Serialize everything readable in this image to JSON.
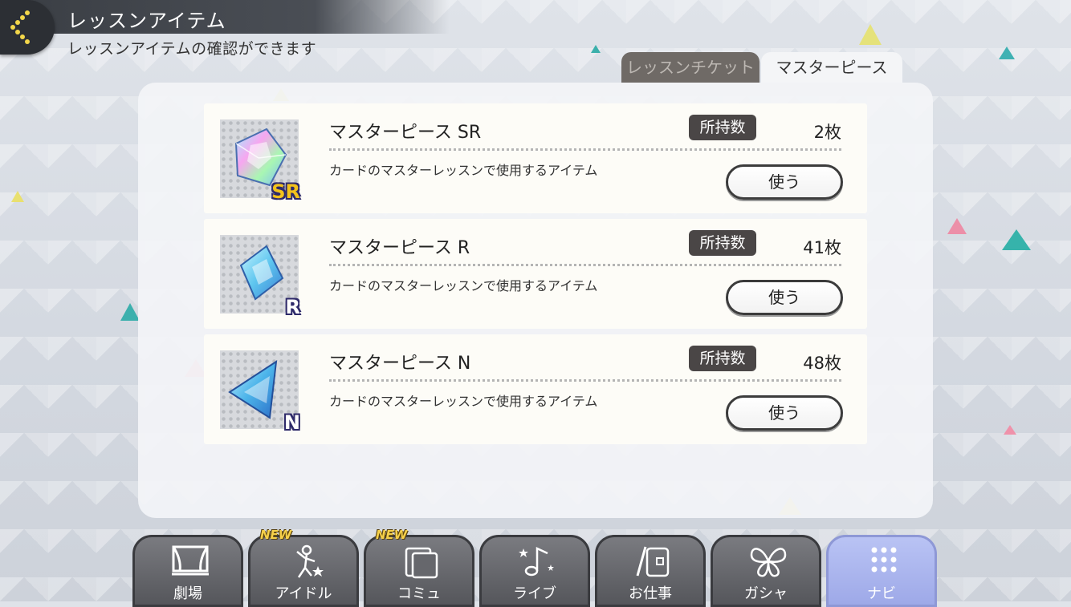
{
  "header": {
    "title": "レッスンアイテム",
    "subtitle": "レッスンアイテムの確認ができます"
  },
  "tabs": [
    {
      "label": "レッスンチケット",
      "active": false
    },
    {
      "label": "マスターピース",
      "active": true
    }
  ],
  "items": [
    {
      "name": "マスターピース SR",
      "owned_label": "所持数",
      "count": "2枚",
      "description": "カードのマスターレッスンで使用するアイテム",
      "use_label": "使う",
      "rarity": "SR"
    },
    {
      "name": "マスターピース R",
      "owned_label": "所持数",
      "count": "41枚",
      "description": "カードのマスターレッスンで使用するアイテム",
      "use_label": "使う",
      "rarity": "R"
    },
    {
      "name": "マスターピース N",
      "owned_label": "所持数",
      "count": "48枚",
      "description": "カードのマスターレッスンで使用するアイテム",
      "use_label": "使う",
      "rarity": "N"
    }
  ],
  "nav": [
    {
      "label": "劇場",
      "icon": "theater-icon"
    },
    {
      "label": "アイドル",
      "icon": "idol-icon",
      "badge": "NEW"
    },
    {
      "label": "コミュ",
      "icon": "folder-icon",
      "badge": "NEW"
    },
    {
      "label": "ライブ",
      "icon": "music-note-icon"
    },
    {
      "label": "お仕事",
      "icon": "notebook-icon"
    },
    {
      "label": "ガシャ",
      "icon": "butterfly-icon"
    },
    {
      "label": "ナビ",
      "icon": "grid-icon",
      "active": true
    }
  ],
  "colors": {
    "accent_active_tab": "#f4f5f7",
    "nav_active": "#a9b4ee",
    "badge_bg": "#4a4646",
    "sr_gold": "#f3c21c"
  }
}
